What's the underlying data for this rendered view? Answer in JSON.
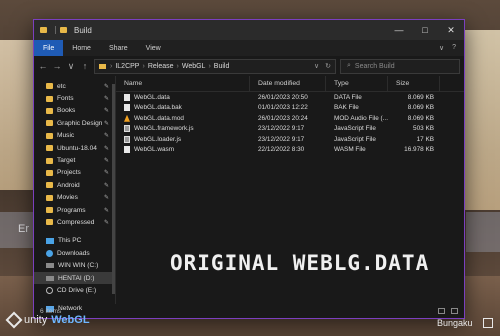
{
  "window": {
    "title": "Build",
    "accent": "#7b3fbf",
    "controls": [
      "—",
      "□",
      "✕"
    ]
  },
  "ribbon": {
    "tabs": [
      "File",
      "Home",
      "Share",
      "View"
    ],
    "right": [
      "∨",
      "?"
    ]
  },
  "address": {
    "crumbs": [
      "IL2CPP",
      "Release",
      "WebGL",
      "Build"
    ],
    "search_placeholder": "Search Build"
  },
  "sidebar": {
    "quick": [
      {
        "label": "etc",
        "pinned": true
      },
      {
        "label": "Fonts",
        "pinned": true
      },
      {
        "label": "Books",
        "pinned": true
      },
      {
        "label": "Graphic Design",
        "pinned": true
      },
      {
        "label": "Music",
        "pinned": true
      },
      {
        "label": "Ubuntu-18.04",
        "pinned": true
      },
      {
        "label": "Target",
        "pinned": true
      },
      {
        "label": "Projects",
        "pinned": true
      },
      {
        "label": "Android",
        "pinned": true
      },
      {
        "label": "Movies",
        "pinned": true
      },
      {
        "label": "Programs",
        "pinned": true
      },
      {
        "label": "Compressed",
        "pinned": true
      }
    ],
    "this_pc": "This PC",
    "locations": [
      "Downloads",
      "WIN WIN (C:)",
      "HENTAI (D:)",
      "CD Drive (E:)"
    ],
    "network": "Network",
    "pin_glyph": "✎"
  },
  "columns": {
    "name": "Name",
    "date": "Date modified",
    "type": "Type",
    "size": "Size"
  },
  "files": [
    {
      "name": "WebGL.data",
      "date": "26/01/2023 20:50",
      "type": "DATA File",
      "size": "8.069 KB",
      "icon": "file"
    },
    {
      "name": "WebGL.data.bak",
      "date": "01/01/2023 12:22",
      "type": "BAK File",
      "size": "8.069 KB",
      "icon": "file"
    },
    {
      "name": "WebGL.data.mod",
      "date": "26/01/2023 20:24",
      "type": "MOD Audio File (...",
      "size": "8.069 KB",
      "icon": "mod"
    },
    {
      "name": "WebGL.framework.js",
      "date": "23/12/2022 9:17",
      "type": "JavaScript File",
      "size": "503 KB",
      "icon": "js"
    },
    {
      "name": "WebGL.loader.js",
      "date": "23/12/2022 9:17",
      "type": "JavaScript File",
      "size": "17 KB",
      "icon": "js"
    },
    {
      "name": "WebGL.wasm",
      "date": "22/12/2022 8:30",
      "type": "WASM File",
      "size": "16.978 KB",
      "icon": "file"
    }
  ],
  "overlay_text": "ORIGINAL WEBLG.DATA",
  "status": {
    "items": "6 items"
  },
  "background": {
    "left_panel_text": "Er"
  },
  "footer": {
    "unity": "unity",
    "webgl": "WebGL",
    "title": "Bungaku"
  }
}
